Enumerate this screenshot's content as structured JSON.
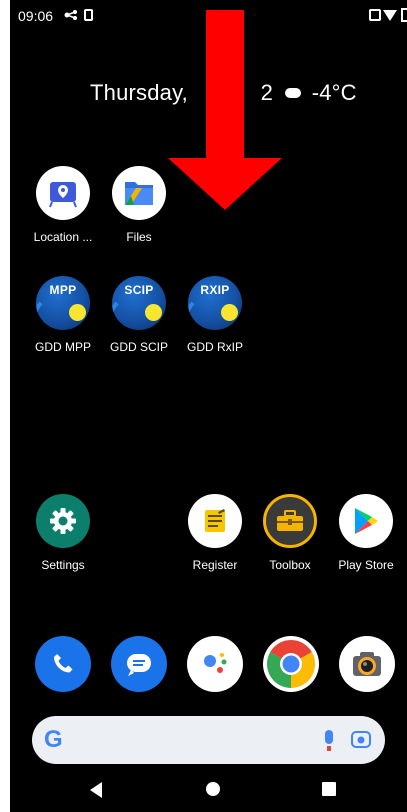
{
  "status_bar": {
    "time": "09:06"
  },
  "date_widget": {
    "date": "Thursday,",
    "date_tail": "2",
    "temperature": "-4°C"
  },
  "apps_row1": [
    {
      "label": "Location ...",
      "icon": "location-map-icon"
    },
    {
      "label": "Files",
      "icon": "files-icon"
    }
  ],
  "apps_row2": [
    {
      "label": "GDD MPP",
      "icon_text": "MPP"
    },
    {
      "label": "GDD SCIP",
      "icon_text": "SCIP"
    },
    {
      "label": "GDD RxIP",
      "icon_text": "RXIP"
    }
  ],
  "apps_row3": [
    {
      "label": "Settings",
      "icon": "gear-icon"
    },
    {
      "label": "Register",
      "icon": "register-notepad-icon"
    },
    {
      "label": "Toolbox",
      "icon": "toolbox-icon"
    },
    {
      "label": "Play Store",
      "icon": "play-store-icon"
    }
  ],
  "dock": [
    "phone-icon",
    "messages-icon",
    "assistant-icon",
    "chrome-icon",
    "camera-icon"
  ],
  "search": {
    "logo": "G"
  },
  "colors": {
    "background": "#000000",
    "arrow": "#ff0000",
    "gdd_blue": "#1551a4",
    "gdd_dot": "#f7e530"
  }
}
